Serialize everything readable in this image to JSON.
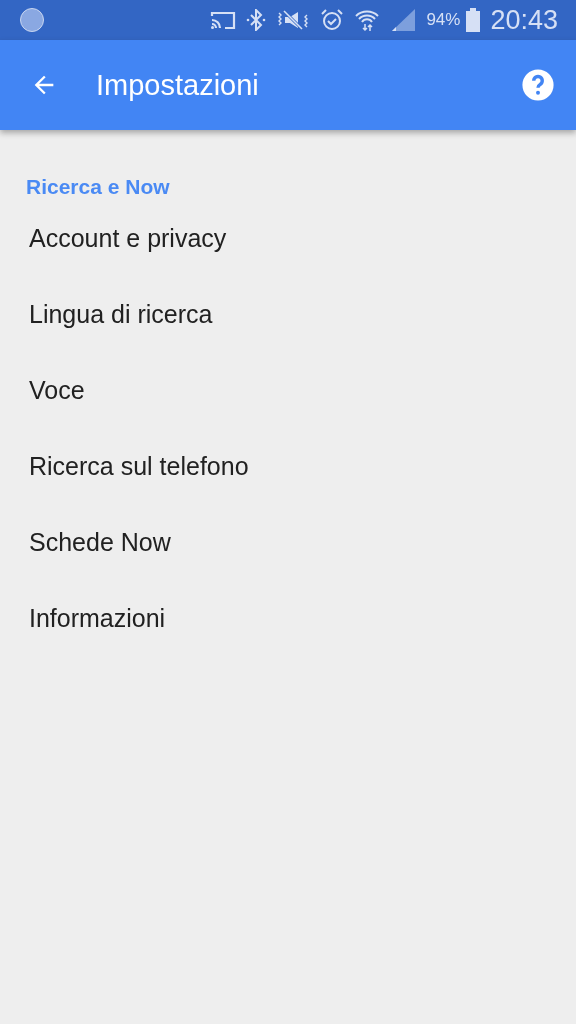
{
  "status_bar": {
    "battery": "94%",
    "time": "20:43"
  },
  "app_bar": {
    "title": "Impostazioni"
  },
  "section": {
    "title": "Ricerca e Now"
  },
  "items": [
    {
      "label": "Account e privacy"
    },
    {
      "label": "Lingua di ricerca"
    },
    {
      "label": "Voce"
    },
    {
      "label": "Ricerca sul telefono"
    },
    {
      "label": "Schede Now"
    },
    {
      "label": "Informazioni"
    }
  ]
}
